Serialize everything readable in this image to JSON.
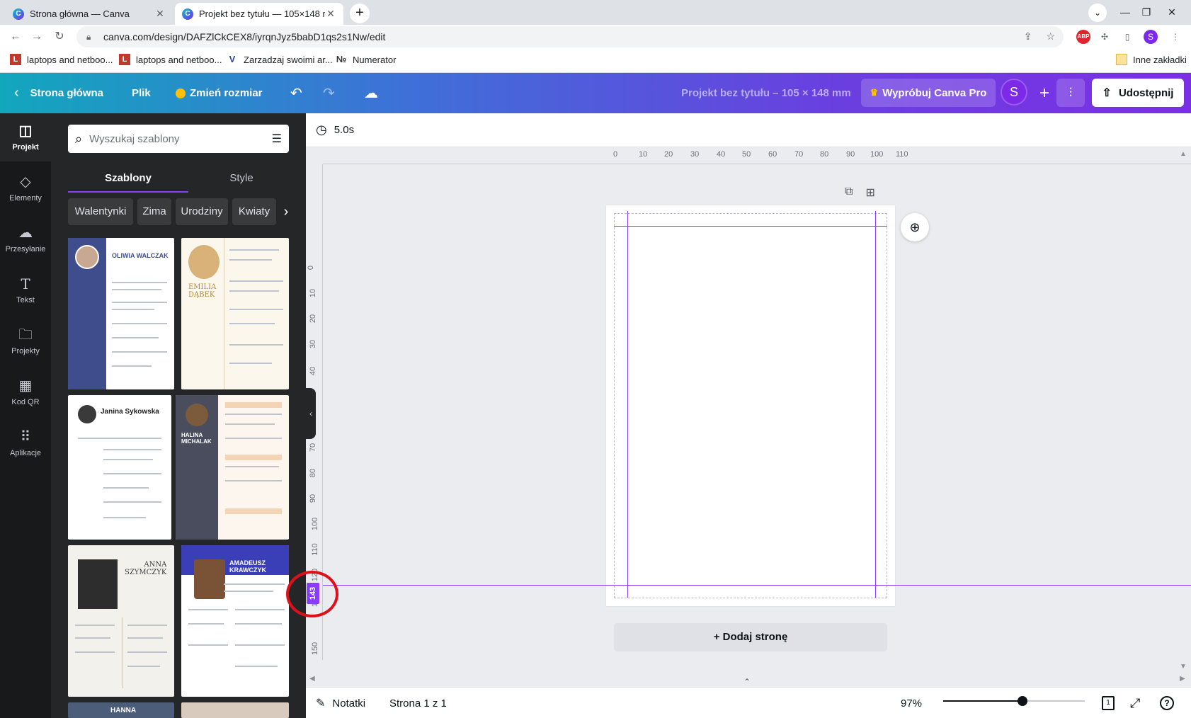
{
  "browser": {
    "tabs": [
      {
        "title": "Strona główna — Canva"
      },
      {
        "title": "Projekt bez tytułu — 105×148 m"
      }
    ],
    "url": "canva.com/design/DAFZlCkCEX8/iyrqnJyz5babD1qs2s1Nw/edit",
    "profile_initial": "S",
    "bookmarks": [
      {
        "label": "laptops and netboo...",
        "icon": "L"
      },
      {
        "label": "laptops and netboo...",
        "icon": "L"
      },
      {
        "label": "Zarzadzaj swoimi ar...",
        "icon": "V"
      },
      {
        "label": "Numerator",
        "icon": "№"
      }
    ],
    "other_bookmarks": "Inne zakładki",
    "adblock_label": "ABP"
  },
  "header": {
    "home": "Strona główna",
    "file": "Plik",
    "resize": "Zmień rozmiar",
    "project_title": "Projekt bez tytułu – 105 × 148 mm",
    "try_pro": "Wypróbuj Canva Pro",
    "avatar_initial": "S",
    "share": "Udostępnij"
  },
  "rail": [
    {
      "label": "Projekt",
      "icon": "layout-icon"
    },
    {
      "label": "Elementy",
      "icon": "shapes-icon"
    },
    {
      "label": "Przesyłanie",
      "icon": "cloud-upload-icon"
    },
    {
      "label": "Tekst",
      "icon": "text-icon"
    },
    {
      "label": "Projekty",
      "icon": "folder-icon"
    },
    {
      "label": "Kod QR",
      "icon": "qr-code-icon"
    },
    {
      "label": "Aplikacje",
      "icon": "apps-grid-icon"
    }
  ],
  "panel": {
    "search_placeholder": "Wyszukaj szablony",
    "tabs": [
      "Szablony",
      "Style"
    ],
    "chips": [
      "Walentynki",
      "Zima",
      "Urodziny",
      "Kwiaty"
    ],
    "templates": [
      {
        "name": "OLIWIA WALCZAK"
      },
      {
        "name": "EMILIA\nDĄBEK"
      },
      {
        "name": "Janina Sykowska"
      },
      {
        "name": "HALINA\nMICHALAK"
      },
      {
        "name": "ANNA\nSZYMCZYK"
      },
      {
        "name": "AMADEUSZ\nKRAWCZYK"
      },
      {
        "name": "HANNA"
      }
    ]
  },
  "editor": {
    "timer": "5.0s",
    "ruler_h": [
      "0",
      "10",
      "20",
      "30",
      "40",
      "50",
      "60",
      "70",
      "80",
      "90",
      "100",
      "110"
    ],
    "ruler_v": [
      "0",
      "10",
      "20",
      "30",
      "40",
      "50",
      "60",
      "70",
      "80",
      "90",
      "100",
      "110",
      "120",
      "130",
      "150"
    ],
    "guide_marker": "143",
    "add_page": "+ Dodaj stronę"
  },
  "footer": {
    "notes": "Notatki",
    "page_count": "Strona 1 z 1",
    "zoom": "97%",
    "zoom_fraction": 0.56,
    "page_badge": "1",
    "help": "?"
  },
  "colors": {
    "accent": "#8b3dff",
    "annotation_circle": "#e0101a",
    "rail_bg": "#18191b",
    "panel_bg": "#252627"
  }
}
